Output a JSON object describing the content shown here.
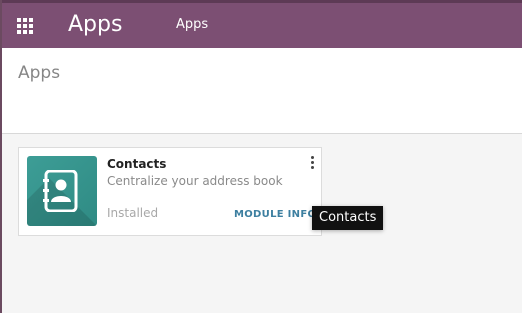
{
  "navbar": {
    "brand": "Apps",
    "menu_items": [
      "Apps"
    ],
    "menu_icon": "grid-icon",
    "color": "#7c4f73"
  },
  "control_panel": {
    "breadcrumb": "Apps"
  },
  "kanban": {
    "cards": [
      {
        "title": "Contacts",
        "summary": "Centralize your address book",
        "status": "Installed",
        "action": "MODULE INFO",
        "icon": "address-book-icon",
        "icon_color": "#3d9d96"
      }
    ]
  },
  "tooltip": {
    "text": "Contacts"
  }
}
